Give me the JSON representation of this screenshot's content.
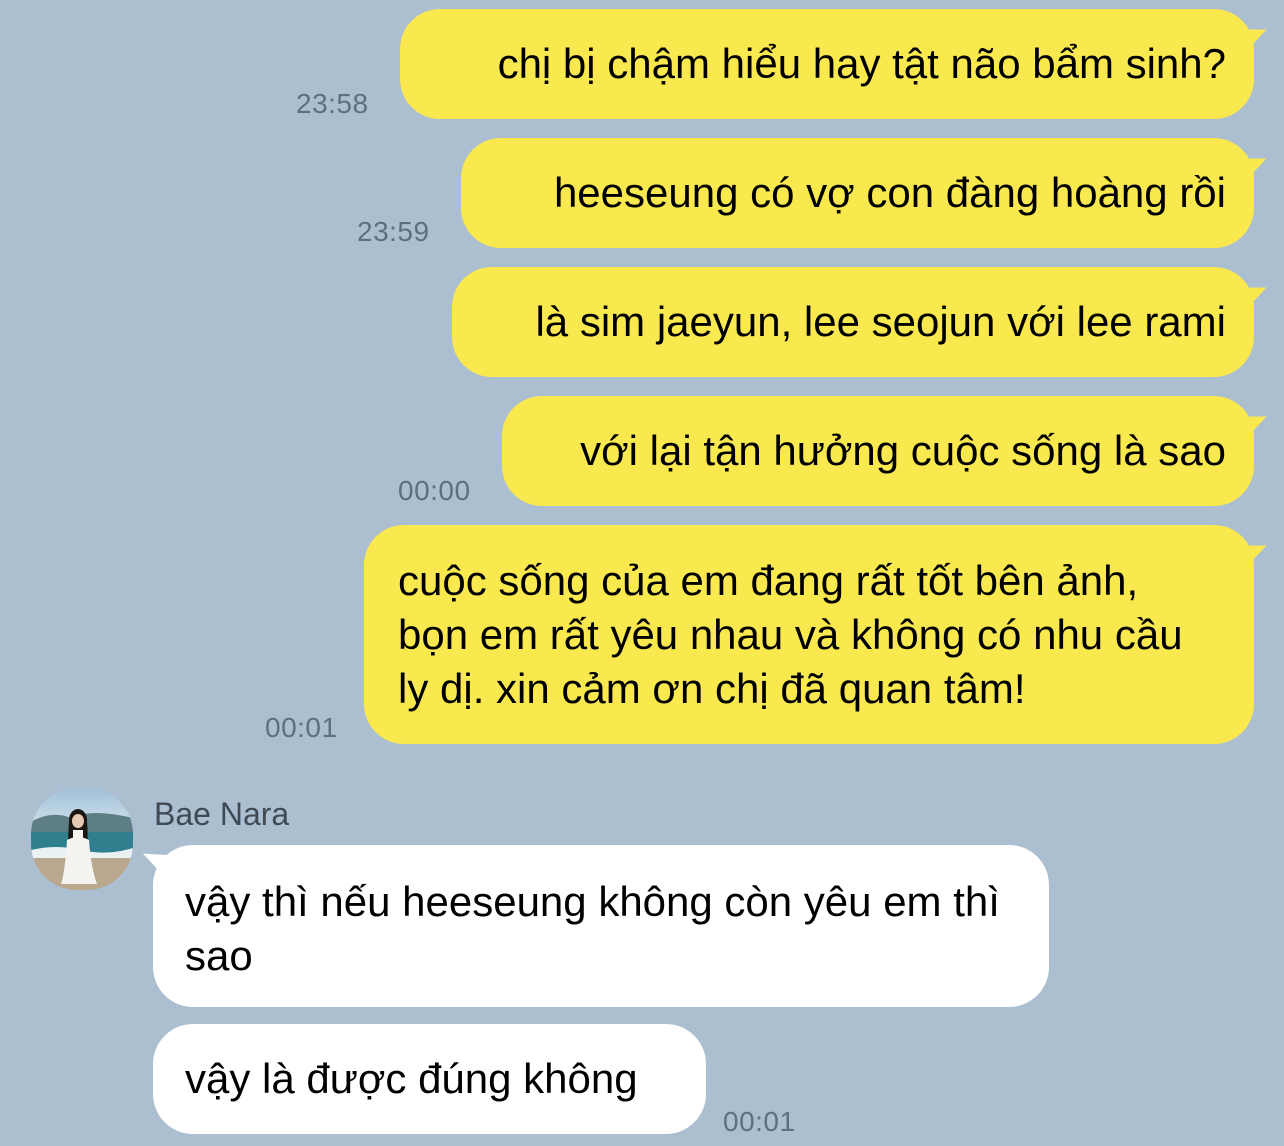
{
  "contact": {
    "name": "Bae Nara",
    "avatar_icon": "profile-photo-beach"
  },
  "colors": {
    "background": "#abbfd1",
    "outgoing_bubble": "#fae84f",
    "incoming_bubble": "#ffffff",
    "timestamp": "#5f6f80"
  },
  "messages": [
    {
      "direction": "outgoing",
      "text": "chị bị chậm hiểu hay tật não bẩm sinh?",
      "time": "23:58"
    },
    {
      "direction": "outgoing",
      "text": "heeseung có vợ con đàng hoàng rồi",
      "time": "23:59"
    },
    {
      "direction": "outgoing",
      "text": "là sim jaeyun, lee seojun với lee rami",
      "time": ""
    },
    {
      "direction": "outgoing",
      "text": "với lại tận hưởng cuộc sống là sao",
      "time": "00:00"
    },
    {
      "direction": "outgoing",
      "text": "cuộc sống của em đang rất tốt bên ảnh, bọn em rất yêu nhau và không có nhu cầu ly dị. xin cảm ơn chị đã quan tâm!",
      "time": "00:01"
    },
    {
      "direction": "incoming",
      "text": "vậy thì nếu heeseung không còn yêu em thì sao",
      "time": ""
    },
    {
      "direction": "incoming",
      "text": "vậy là được đúng không",
      "time": "00:01"
    }
  ]
}
